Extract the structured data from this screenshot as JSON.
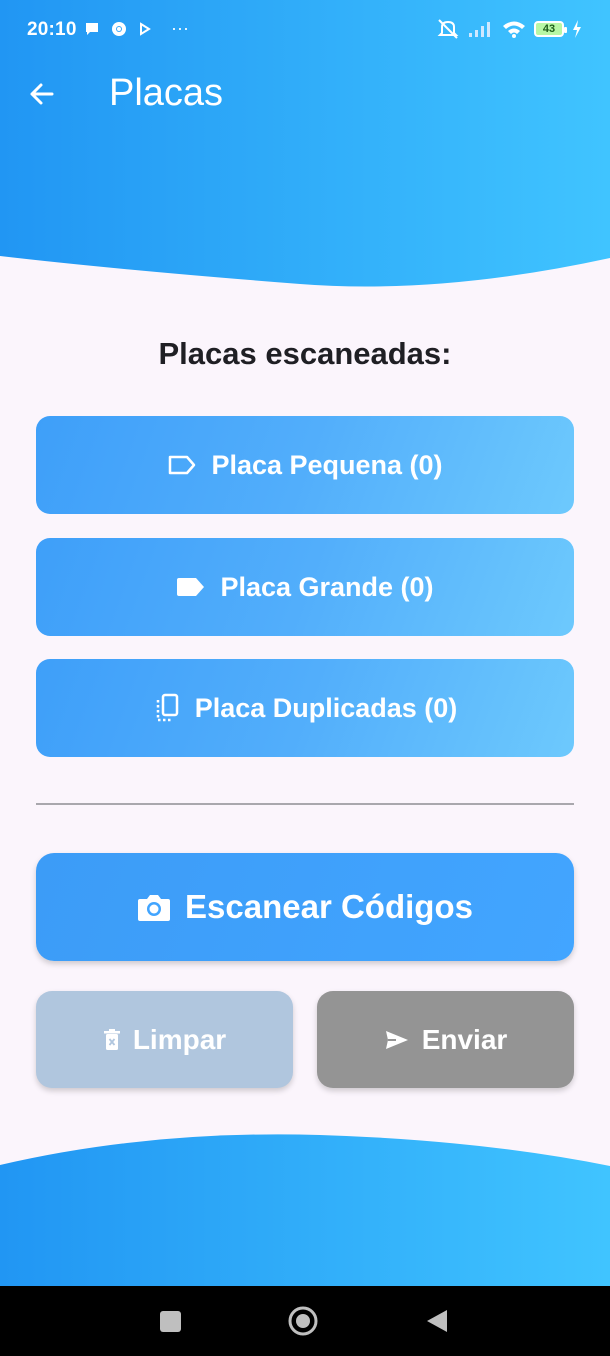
{
  "status_bar": {
    "time": "20:10",
    "dots": "···",
    "battery": "43",
    "icons": [
      "chat-icon",
      "chrome-icon",
      "play-icon",
      "mute-icon",
      "signal-icon",
      "wifi-icon",
      "battery-icon",
      "charging-icon"
    ]
  },
  "app_bar": {
    "title": "Placas",
    "back_icon": "arrow-left-icon"
  },
  "main": {
    "section_title": "Placas escaneadas:",
    "plates": [
      {
        "label": "Placa Pequena (0)",
        "icon": "label-outline-icon"
      },
      {
        "label": "Placa Grande (0)",
        "icon": "label-filled-icon"
      },
      {
        "label": "Placa Duplicadas (0)",
        "icon": "duplicate-icon"
      }
    ],
    "scan_label": "Escanear Códigos",
    "clear_label": "Limpar",
    "send_label": "Enviar"
  },
  "colors": {
    "primary": "#42a5ff",
    "gradient_start": "#2196f3",
    "gradient_end": "#40c4ff",
    "clear_disabled": "#b0c6de",
    "send_disabled": "#949494",
    "background": "#fbf5fc"
  }
}
